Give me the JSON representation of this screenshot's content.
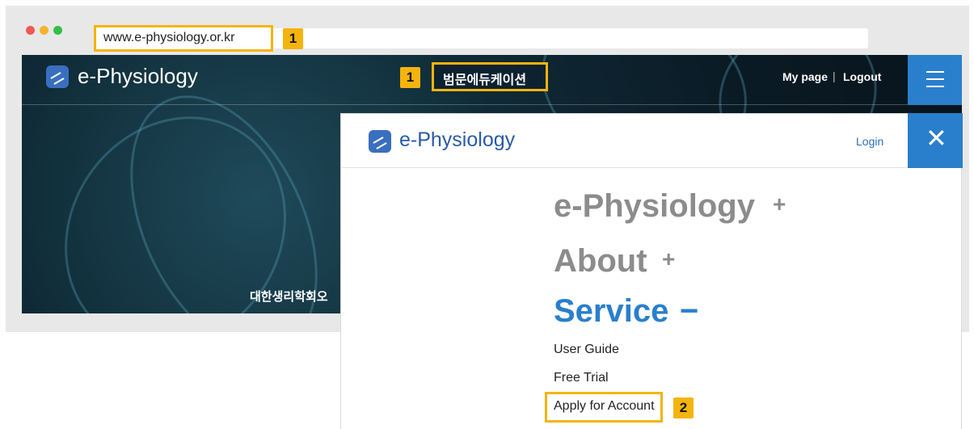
{
  "browser": {
    "url": "www.e-physiology.or.kr",
    "url_badge": "1"
  },
  "site": {
    "logo_text": "e-Physiology",
    "hero_title": "범문에듀케이션",
    "hero_badge": "1",
    "my_page": "My page",
    "separator": "|",
    "logout": "Logout",
    "hero_caption": "대한생리학회오"
  },
  "menu_panel": {
    "logo_text": "e-Physiology",
    "login": "Login",
    "close_symbol": "✕",
    "items": [
      {
        "label": "e-Physiology",
        "sign": "+"
      },
      {
        "label": "About",
        "sign": "+"
      },
      {
        "label": "Service",
        "sign": "−"
      }
    ],
    "sub_items": [
      {
        "label": "User Guide"
      },
      {
        "label": "Free Trial"
      },
      {
        "label": "Apply for Account",
        "badge": "2"
      }
    ]
  },
  "colors": {
    "highlight": "#f5b40d",
    "accent_blue": "#2a7fcc",
    "menu_gray": "#8c8c8c"
  }
}
